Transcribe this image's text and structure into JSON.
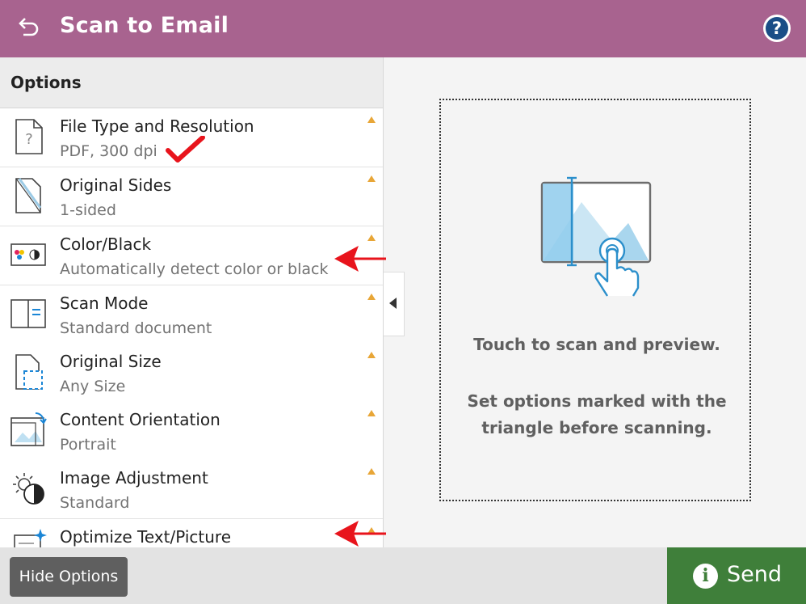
{
  "header": {
    "title": "Scan to Email",
    "help_label": "?"
  },
  "options_panel": {
    "heading": "Options",
    "items": [
      {
        "name": "File Type and Resolution",
        "value": "PDF, 300 dpi",
        "icon": "file-question-icon"
      },
      {
        "name": "Original Sides",
        "value": "1-sided",
        "icon": "page-sides-icon"
      },
      {
        "name": "Color/Black",
        "value": "Automatically detect color or black",
        "icon": "color-black-icon"
      },
      {
        "name": "Scan Mode",
        "value": "Standard document",
        "icon": "book-icon"
      },
      {
        "name": "Original Size",
        "value": "Any Size",
        "icon": "page-size-icon"
      },
      {
        "name": "Content Orientation",
        "value": "Portrait",
        "icon": "orientation-icon"
      },
      {
        "name": "Image Adjustment",
        "value": "Standard",
        "icon": "brightness-contrast-icon"
      },
      {
        "name": "Optimize Text/Picture",
        "value": "",
        "icon": "optimize-icon"
      }
    ]
  },
  "preview": {
    "message": "Touch to scan and preview.",
    "instruction": "Set options marked with the triangle before scanning."
  },
  "footer": {
    "hide_options_label": "Hide Options",
    "send_label": "Send",
    "send_icon_glyph": "i"
  },
  "colors": {
    "header": "#a8638f",
    "send": "#3f7f3a",
    "triangle": "#e8a637",
    "annotation": "#e8141c"
  }
}
